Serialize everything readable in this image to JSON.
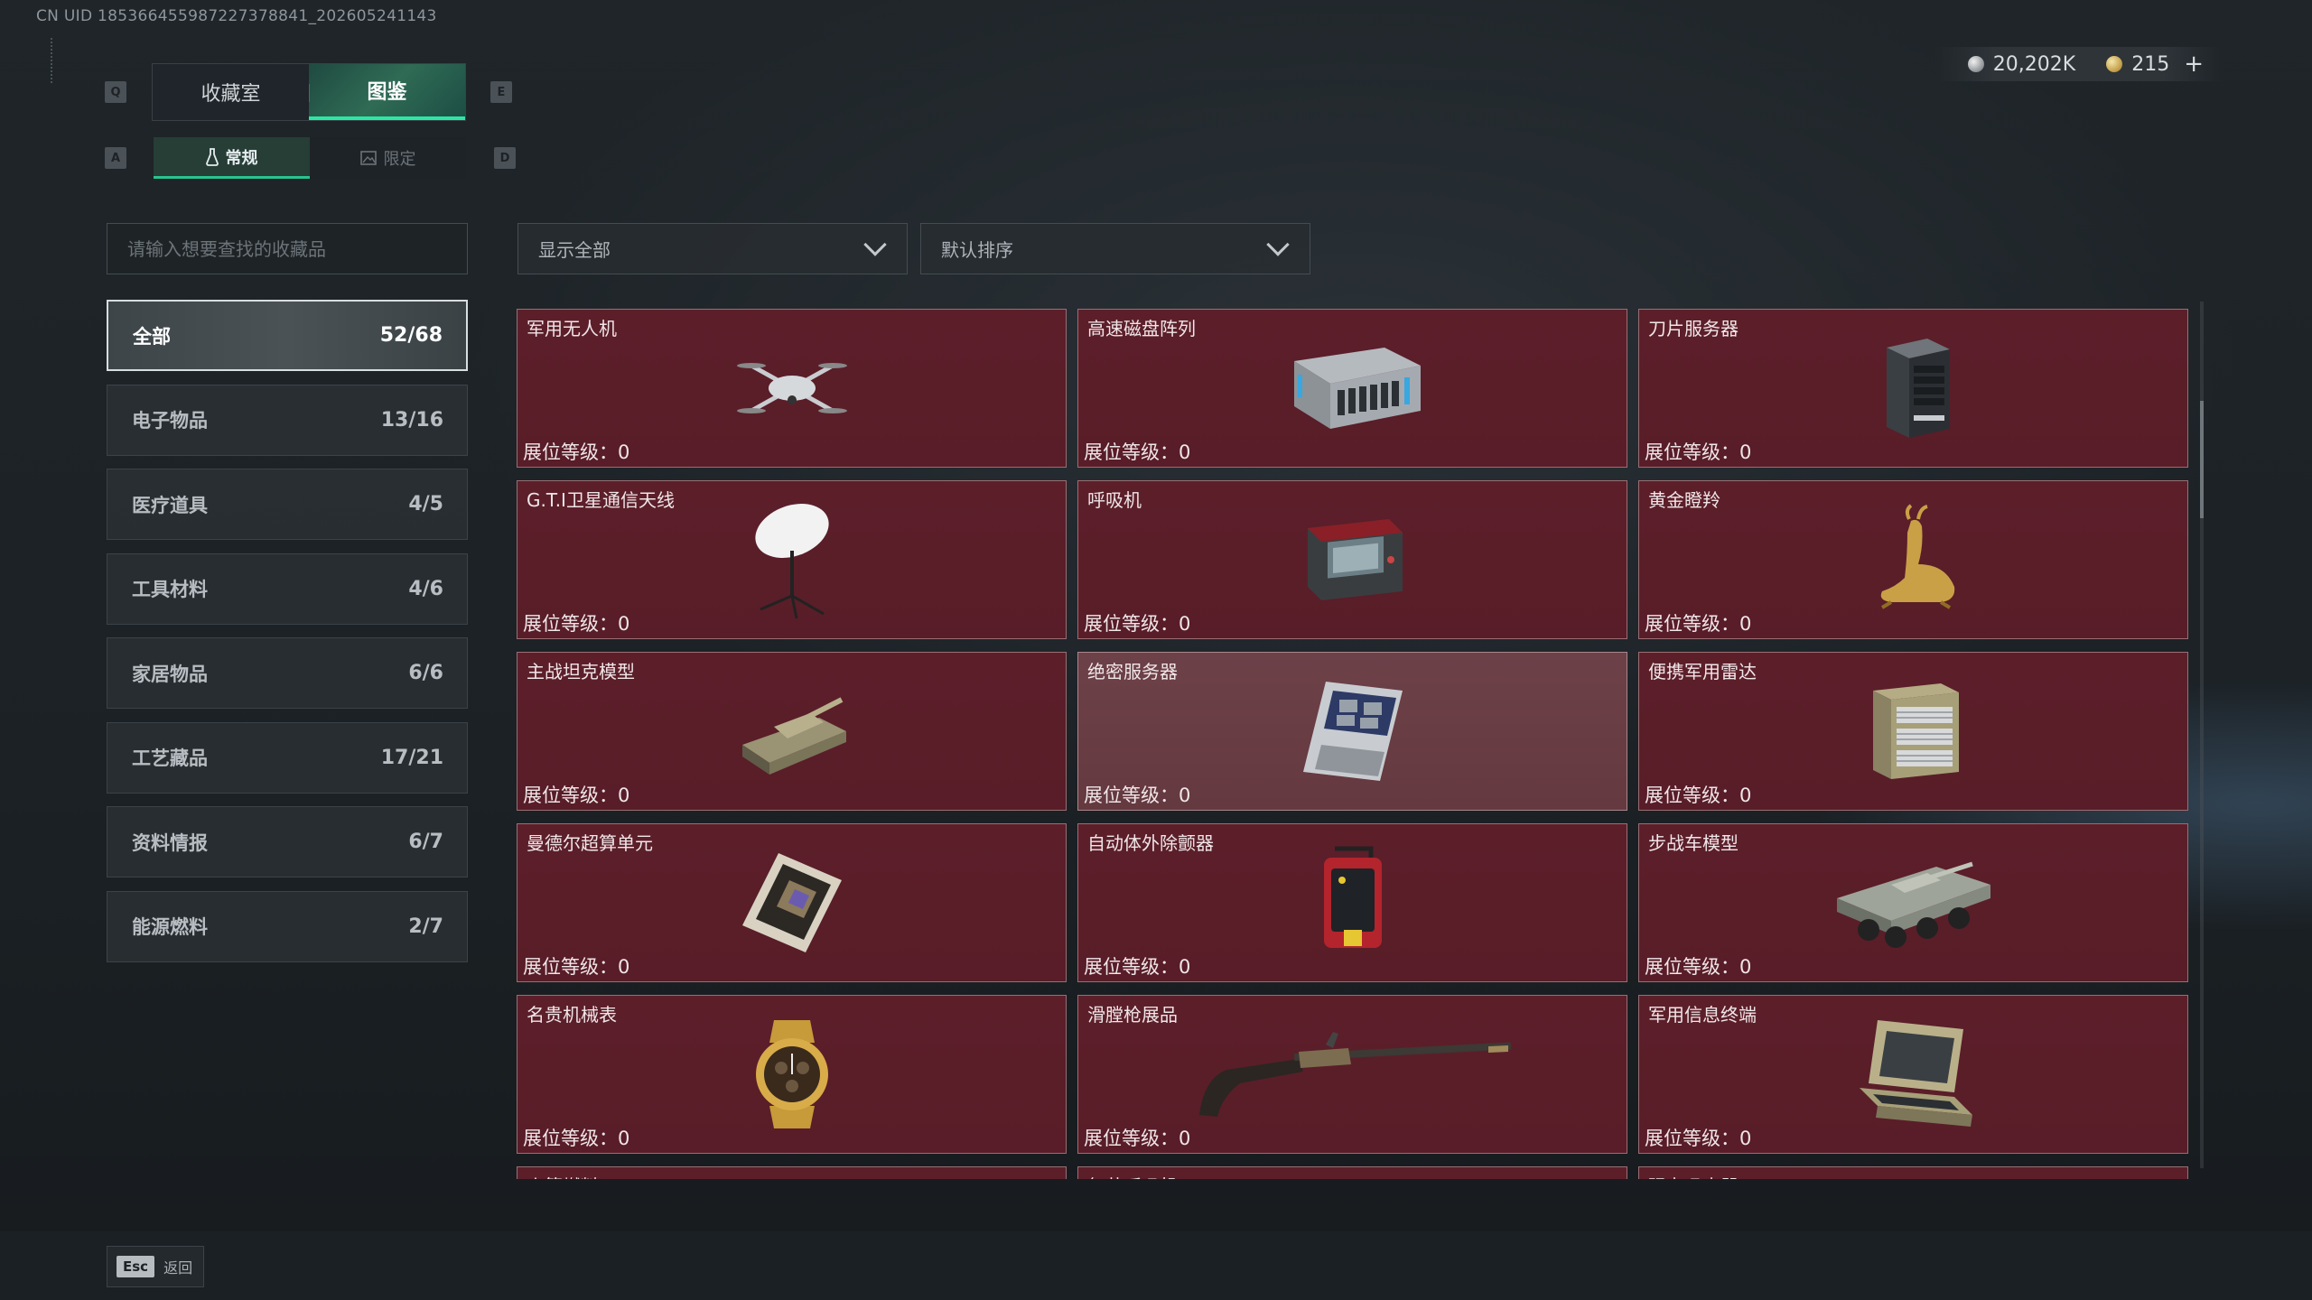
{
  "uid": "CN UID 185366455987227378841_202605241143",
  "keys": {
    "q": "Q",
    "e": "E",
    "a": "A",
    "d": "D"
  },
  "main_tabs": [
    {
      "label": "收藏室"
    },
    {
      "label": "图鉴"
    }
  ],
  "sub_tabs": [
    {
      "label": "常规"
    },
    {
      "label": "限定"
    }
  ],
  "currencies": {
    "silver": "20,202K",
    "gold": "215",
    "plus": "+"
  },
  "search": {
    "placeholder": "请输入想要查找的收藏品"
  },
  "filter_dropdown": {
    "value": "显示全部"
  },
  "sort_dropdown": {
    "value": "默认排序"
  },
  "categories": [
    {
      "label": "全部",
      "count": "52/68"
    },
    {
      "label": "电子物品",
      "count": "13/16"
    },
    {
      "label": "医疗道具",
      "count": "4/5"
    },
    {
      "label": "工具材料",
      "count": "4/6"
    },
    {
      "label": "家居物品",
      "count": "6/6"
    },
    {
      "label": "工艺藏品",
      "count": "17/21"
    },
    {
      "label": "资料情报",
      "count": "6/7"
    },
    {
      "label": "能源燃料",
      "count": "2/7"
    }
  ],
  "items": [
    {
      "name": "军用无人机",
      "level": "展位等级：0",
      "icon": "drone-icon"
    },
    {
      "name": "高速磁盘阵列",
      "level": "展位等级：0",
      "icon": "disk-array-icon"
    },
    {
      "name": "刀片服务器",
      "level": "展位等级：0",
      "icon": "blade-server-icon"
    },
    {
      "name": "G.T.I卫星通信天线",
      "level": "展位等级：0",
      "icon": "satellite-dish-icon"
    },
    {
      "name": "呼吸机",
      "level": "展位等级：0",
      "icon": "ventilator-icon"
    },
    {
      "name": "黄金瞪羚",
      "level": "展位等级：0",
      "icon": "golden-gazelle-icon"
    },
    {
      "name": "主战坦克模型",
      "level": "展位等级：0",
      "icon": "tank-model-icon"
    },
    {
      "name": "绝密服务器",
      "level": "展位等级：0",
      "icon": "secret-server-icon"
    },
    {
      "name": "便携军用雷达",
      "level": "展位等级：0",
      "icon": "portable-radar-icon"
    },
    {
      "name": "曼德尔超算单元",
      "level": "展位等级：0",
      "icon": "supercomputer-unit-icon"
    },
    {
      "name": "自动体外除颤器",
      "level": "展位等级：0",
      "icon": "defibrillator-icon"
    },
    {
      "name": "步战车模型",
      "level": "展位等级：0",
      "icon": "ifv-model-icon"
    },
    {
      "name": "名贵机械表",
      "level": "展位等级：0",
      "icon": "luxury-watch-icon"
    },
    {
      "name": "滑膛枪展品",
      "level": "展位等级：0",
      "icon": "musket-icon"
    },
    {
      "name": "军用信息终端",
      "level": "展位等级：0",
      "icon": "military-terminal-icon"
    },
    {
      "name": "火箭燃料",
      "level": "",
      "icon": ""
    },
    {
      "name": "复苏呼吸机",
      "level": "",
      "icon": ""
    },
    {
      "name": "强力吸尘器",
      "level": "",
      "icon": ""
    }
  ],
  "footer": {
    "esc_key": "Esc",
    "esc_label": "返回"
  }
}
